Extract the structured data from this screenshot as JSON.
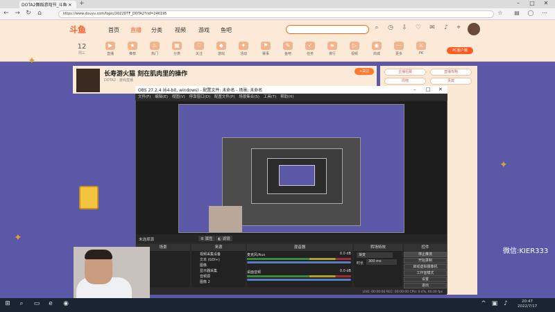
{
  "browser": {
    "tab_title": "DOTA2舞蹈游戏节_斗鱼",
    "new_tab_symbol": "+",
    "url": "https://www.douyu.com/topic/2022DTF_DOTA2?rid=246195",
    "back_icon": "←",
    "forward_icon": "→",
    "refresh_icon": "↻",
    "home_icon": "⌂"
  },
  "site": {
    "logo": "斗鱼",
    "nav": [
      "首页",
      "直播",
      "分类",
      "视频",
      "游戏",
      "鱼吧"
    ],
    "date_num": "12",
    "date_label": "周三",
    "categories": [
      "直播",
      "推荐",
      "热门",
      "分类",
      "关注",
      "游戏",
      "活动",
      "赛事",
      "鱼吧",
      "任务",
      "排行",
      "视频",
      "商城",
      "更多",
      "PK"
    ],
    "pc_button": "PC客户端"
  },
  "room": {
    "title": "长寿游火猫 刻在肌肉里的操作",
    "meta": "DOTA2 · 游戏直播",
    "follow": "+关注"
  },
  "right_panel": {
    "buttons": [
      "主播招募",
      "直播攻略",
      "周榜",
      "贵宾"
    ]
  },
  "watermark": "微信:KIER333",
  "obs": {
    "title": "OBS 27.2.4 (64-bit, windows) - 配置文件: 未命名 - 场景: 未命名",
    "menu": [
      "文件(F)",
      "编辑(E)",
      "视图(V)",
      "停靠窗口(D)",
      "配置文件(P)",
      "场景集合(S)",
      "工具(T)",
      "帮助(H)"
    ],
    "no_source": "未选择源",
    "properties_btn": "属性",
    "filters_btn": "滤镜",
    "docks": {
      "scenes": "场景",
      "sources": "来源",
      "mixer": "混音器",
      "transitions": "转场特效",
      "controls": "控件"
    },
    "sources": [
      "视频采集设备",
      "文本 (GDI+)",
      "图像",
      "显示器采集",
      "音频源",
      "图像 2"
    ],
    "mixer_rows": [
      {
        "name": "麦克风/Aux",
        "db": "0.0 dB"
      },
      {
        "name": "桌面音频",
        "db": "0.0 dB"
      }
    ],
    "transition": {
      "type": "渐变",
      "duration_label": "时长",
      "duration": "300 ms"
    },
    "controls": [
      "停止推流",
      "开始录制",
      "启动虚拟摄像机",
      "工作室模式",
      "设置",
      "退出"
    ],
    "status": "LIVE: 00:00:00   REC: 00:00:00   CPU: 0.4%, 60.00 fps"
  },
  "taskbar": {
    "time": "20:47",
    "date": "2022/7/17"
  },
  "colors": {
    "accent": "#ff5d23",
    "page_bg": "#5b58a8",
    "obs_dark": "#2a2a2a"
  }
}
